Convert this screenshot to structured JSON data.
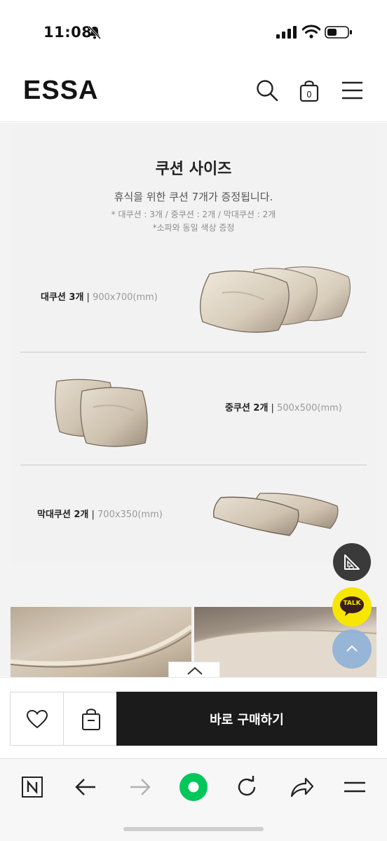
{
  "status_bar": {
    "time": "11:08"
  },
  "header": {
    "logo": "ESSA",
    "cart_count": "0"
  },
  "cushion_section": {
    "title": "쿠션 사이즈",
    "subtitle": "휴식을 위한 쿠션 7개가 증정됩니다.",
    "note_counts": "* 대쿠션 : 3개 / 중쿠션 : 2개 / 막대쿠션 : 2개",
    "note_color": "*소파와 동일 색상 증정",
    "items": [
      {
        "name": "대쿠션 3개",
        "sep": " | ",
        "dim": "900x700(mm)"
      },
      {
        "name": "중쿠션 2개",
        "sep": " | ",
        "dim": "500x500(mm)"
      },
      {
        "name": "막대쿠션 2개",
        "sep": " | ",
        "dim": "700x350(mm)"
      }
    ]
  },
  "floating": {
    "talk_label": "TALK"
  },
  "purchase_bar": {
    "buy_now_label": "바로 구매하기"
  },
  "colors": {
    "buy_button": "#1b1b1b",
    "talk": "#f7e600",
    "scroll_top": "#8fb3d9",
    "naver_green": "#03c75a"
  },
  "icons": [
    "bell-slash-icon",
    "signal-icon",
    "wifi-icon",
    "battery-icon",
    "search-icon",
    "shopping-bag-icon",
    "hamburger-menu-icon",
    "ruler-triangle-icon",
    "kakao-talk-icon",
    "arrow-up-icon",
    "chevron-up-icon",
    "heart-icon",
    "cart-icon",
    "naver-n-icon",
    "back-arrow-icon",
    "forward-arrow-icon",
    "naver-green-dot-icon",
    "refresh-icon",
    "share-icon",
    "menu-lines-icon"
  ]
}
